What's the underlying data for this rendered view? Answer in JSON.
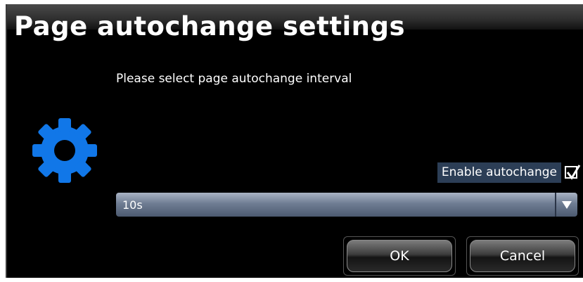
{
  "dialog": {
    "title": "Page autochange settings",
    "prompt": "Please select page autochange interval",
    "icon": "gear-icon",
    "enable_autochange": {
      "label": "Enable autochange",
      "checked": true
    },
    "interval_select": {
      "value": "10s",
      "arrow_icon": "chevron-down-icon"
    },
    "buttons": {
      "ok_label": "OK",
      "cancel_label": "Cancel"
    }
  },
  "colors": {
    "background": "#000000",
    "accent_gear": "#1177e8",
    "label_highlight": "#2c3e56"
  }
}
